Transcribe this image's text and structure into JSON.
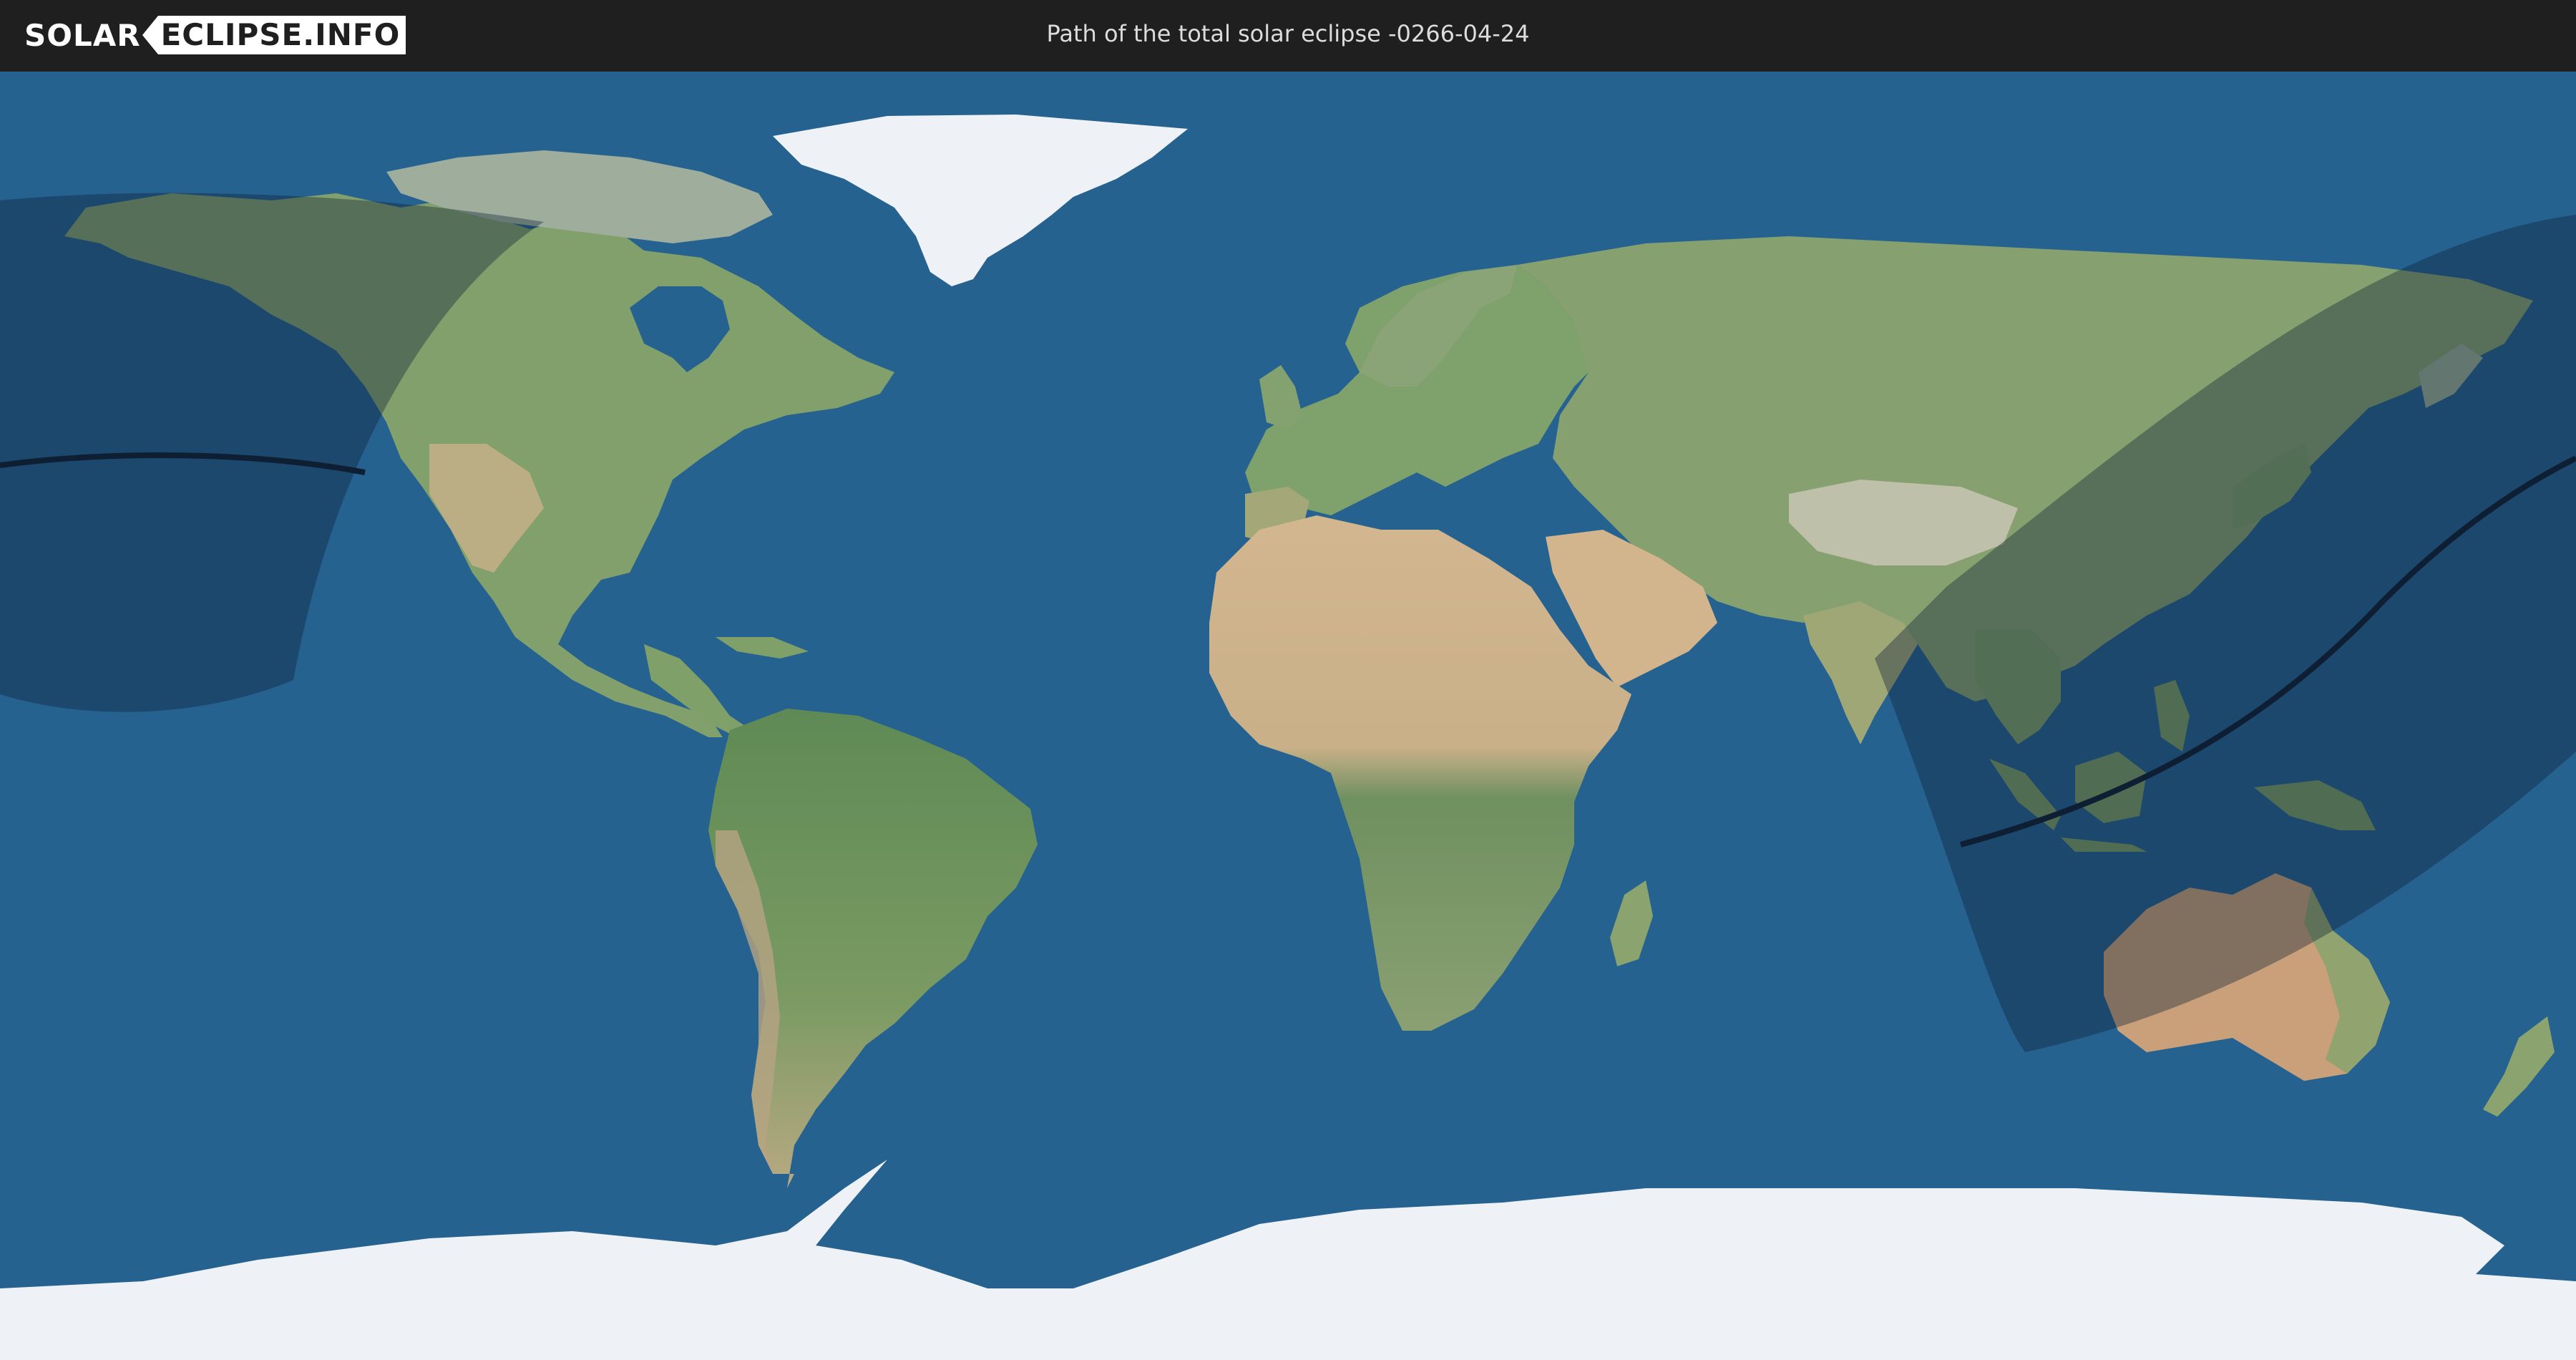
{
  "header": {
    "logo_part1": "SOLAR",
    "logo_part2": "ECLIPSE.INFO",
    "title": "Path of the total solar eclipse -0266-04-24"
  },
  "colors": {
    "header_bg": "#1f1f1f",
    "ocean": "#26628f",
    "land_green": "#7d9a6b",
    "desert": "#cdb48d",
    "ice": "#eef2f6",
    "shadow": "#0e2036",
    "central_line": "#0f1f33"
  },
  "map": {
    "projection": "equirectangular",
    "eclipse_date": "-0266-04-24",
    "eclipse_type": "total"
  }
}
